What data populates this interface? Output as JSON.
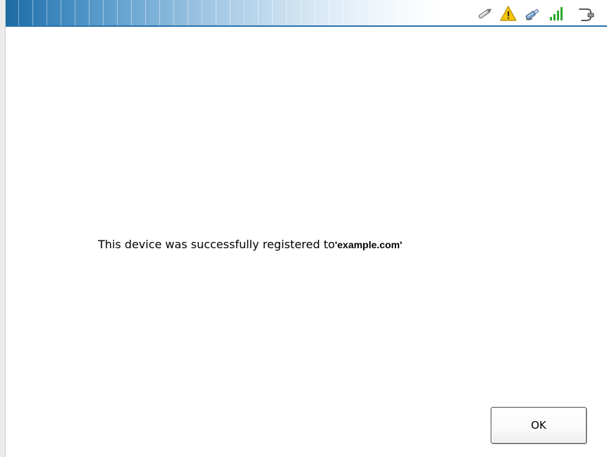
{
  "status_tray": {
    "icons": [
      "pen-icon",
      "warning-icon",
      "network-icon",
      "signal-strength-icon",
      "power-plug-icon"
    ],
    "colors": {
      "warning": "#f5c400",
      "signal": "#2fa830",
      "titlebar_accent": "#1d6aa3"
    }
  },
  "dialog": {
    "message_prefix": "This device was successfully registered to",
    "message_domain": "'example.com'",
    "ok_label": "OK"
  }
}
